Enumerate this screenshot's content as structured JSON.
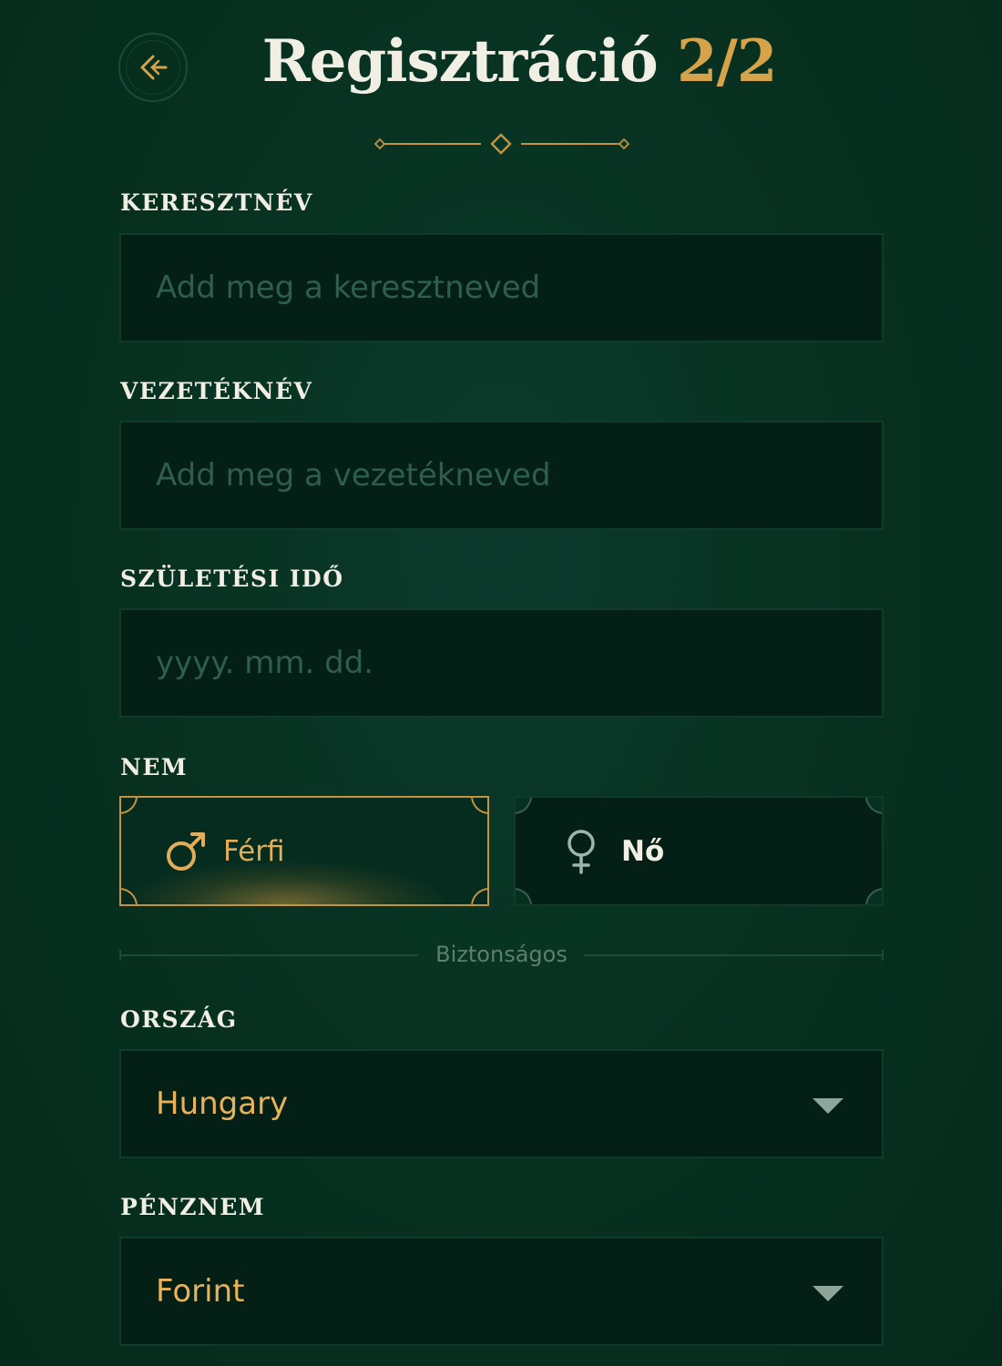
{
  "header": {
    "title": "Regisztráció",
    "step": "2/2"
  },
  "fields": {
    "first_name": {
      "label": "KERESZTNÉV",
      "placeholder": "Add meg a keresztneved",
      "value": ""
    },
    "last_name": {
      "label": "VEZETÉKNÉV",
      "placeholder": "Add meg a vezetékneved",
      "value": ""
    },
    "birth_date": {
      "label": "SZÜLETÉSI IDŐ",
      "placeholder": "yyyy. mm. dd.",
      "value": ""
    }
  },
  "gender": {
    "label": "NEM",
    "options": [
      {
        "label": "Férfi",
        "icon": "male-icon",
        "selected": true
      },
      {
        "label": "Nő",
        "icon": "female-icon",
        "selected": false
      }
    ]
  },
  "divider": {
    "text": "Biztonságos"
  },
  "country": {
    "label": "ORSZÁG",
    "value": "Hungary"
  },
  "currency": {
    "label": "PÉNZNEM",
    "value": "Forint"
  },
  "colors": {
    "background": "#07301f",
    "accent": "#d6a24a",
    "field_bg": "#031f16",
    "placeholder": "#2f5f4c"
  }
}
